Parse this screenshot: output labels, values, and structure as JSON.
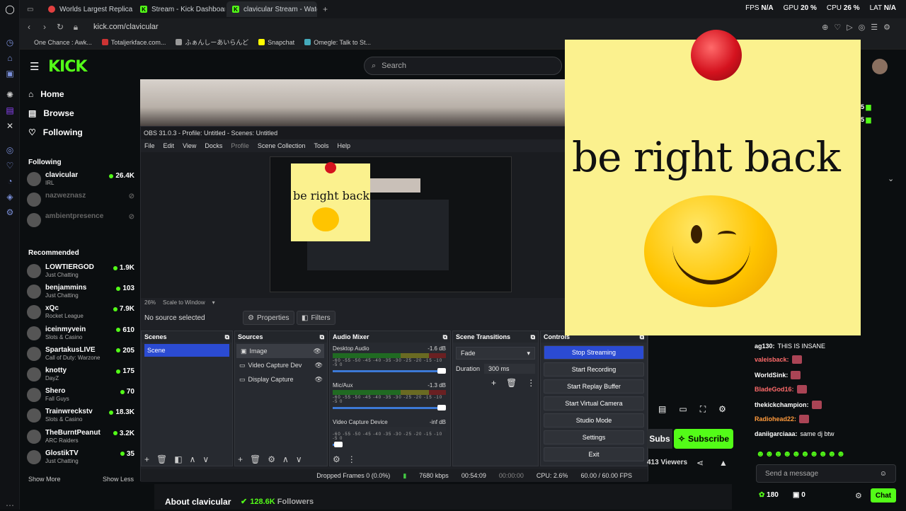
{
  "browser": {
    "tabs": [
      {
        "title": "Worlds Largest Replica Dis"
      },
      {
        "title": "Stream - Kick Dashboard"
      },
      {
        "title": "clavicular Stream - Watch"
      }
    ],
    "url": "kick.com/clavicular",
    "stats": {
      "fps_label": "FPS",
      "fps": "N/A",
      "gpu_label": "GPU",
      "gpu": "20 %",
      "cpu_label": "CPU",
      "cpu": "26 %",
      "lat_label": "LAT",
      "lat": "N/A"
    },
    "bookmarks": [
      "One Chance : Awk...",
      "Totaljerkface.com...",
      "ふぁんしーあいらんど",
      "Snapchat",
      "Omegle: Talk to St..."
    ]
  },
  "kick": {
    "logo": "KICK",
    "search_placeholder": "Search",
    "nav": [
      "Home",
      "Browse",
      "Following"
    ],
    "following_title": "Following",
    "following": [
      {
        "name": "clavicular",
        "category": "IRL",
        "viewers": "26.4K",
        "live": true
      },
      {
        "name": "nazweznasz",
        "category": "",
        "viewers": "",
        "live": false
      },
      {
        "name": "ambientpresence",
        "category": "",
        "viewers": "",
        "live": false
      }
    ],
    "recommended_title": "Recommended",
    "recommended": [
      {
        "name": "LOWTIERGOD",
        "category": "Just Chatting",
        "viewers": "1.9K"
      },
      {
        "name": "benjammins",
        "category": "Just Chatting",
        "viewers": "103"
      },
      {
        "name": "xQc",
        "category": "Rocket League",
        "viewers": "7.9K"
      },
      {
        "name": "iceinmyvein",
        "category": "Slots & Casino",
        "viewers": "610"
      },
      {
        "name": "SpartakusLIVE",
        "category": "Call of Duty: Warzone",
        "viewers": "205"
      },
      {
        "name": "knotty",
        "category": "DayZ",
        "viewers": "175"
      },
      {
        "name": "Shero",
        "category": "Fall Guys",
        "viewers": "70"
      },
      {
        "name": "Trainwreckstv",
        "category": "Slots & Casino",
        "viewers": "18.3K"
      },
      {
        "name": "TheBurntPeanut",
        "category": "ARC Raiders",
        "viewers": "3.2K"
      },
      {
        "name": "GlostikTV",
        "category": "Just Chatting",
        "viewers": "35"
      }
    ],
    "show_more": "Show More",
    "show_less": "Show Less",
    "about_title": "About clavicular",
    "followers": "128.6K",
    "followers_label": "Followers",
    "subs_label": "Subs",
    "subscribe_label": "Subscribe",
    "viewers_count": "413",
    "viewers_label": "Viewers"
  },
  "obs": {
    "title": "OBS 31.0.3 - Profile: Untitled - Scenes: Untitled",
    "menu": [
      "File",
      "Edit",
      "View",
      "Docks",
      "Profile",
      "Scene Collection",
      "Tools",
      "Help"
    ],
    "zoom": "26%",
    "scale": "Scale to Window",
    "no_source": "No source selected",
    "properties": "Properties",
    "filters": "Filters",
    "scenes_title": "Scenes",
    "scenes": [
      "Scene"
    ],
    "sources_title": "Sources",
    "sources": [
      "Image",
      "Video Capture Dev",
      "Display Capture"
    ],
    "mixer_title": "Audio Mixer",
    "mixer": [
      {
        "name": "Desktop Audio",
        "db": "-1.6 dB"
      },
      {
        "name": "Mic/Aux",
        "db": "-1.3 dB"
      },
      {
        "name": "Video Capture Device",
        "db": "-inf dB"
      }
    ],
    "meter_scale": "-60 -55 -50 -45 -40 -35 -30 -25 -20 -15 -10 -5 0",
    "transitions_title": "Scene Transitions",
    "transition": "Fade",
    "duration_label": "Duration",
    "duration": "300 ms",
    "controls_title": "Controls",
    "controls": [
      "Stop Streaming",
      "Start Recording",
      "Start Replay Buffer",
      "Start Virtual Camera",
      "Studio Mode",
      "Settings",
      "Exit"
    ],
    "status": {
      "dropped": "Dropped Frames 0 (0.0%)",
      "kbps": "7680 kbps",
      "stream_time": "00:54:09",
      "rec_time": "00:00:00",
      "cpu": "CPU: 2.6%",
      "fps": "60.00 / 60.00 FPS"
    }
  },
  "overlay": {
    "text": "be right back"
  },
  "chat": {
    "messages": [
      {
        "user": "ag130",
        "text": "THIS IS INSANE",
        "color": "#ffffff"
      },
      {
        "user": "valeisback",
        "text": "",
        "color": "#ff6b6b"
      },
      {
        "user": "WorldSink",
        "text": "",
        "color": "#ffffff"
      },
      {
        "user": "BladeGod16",
        "text": "",
        "color": "#ff6b6b"
      },
      {
        "user": "thekickchampion",
        "text": "",
        "color": "#ffffff"
      },
      {
        "user": "Radiohead22",
        "text": "",
        "color": "#ff9a3c"
      },
      {
        "user": "daniigarciaaa",
        "text": "same dj btw",
        "color": "#ffffff"
      }
    ],
    "placeholder": "Send a message",
    "points": "180",
    "gifts": "0",
    "chat_button": "Chat",
    "sub_counts": [
      "5",
      "5"
    ]
  }
}
